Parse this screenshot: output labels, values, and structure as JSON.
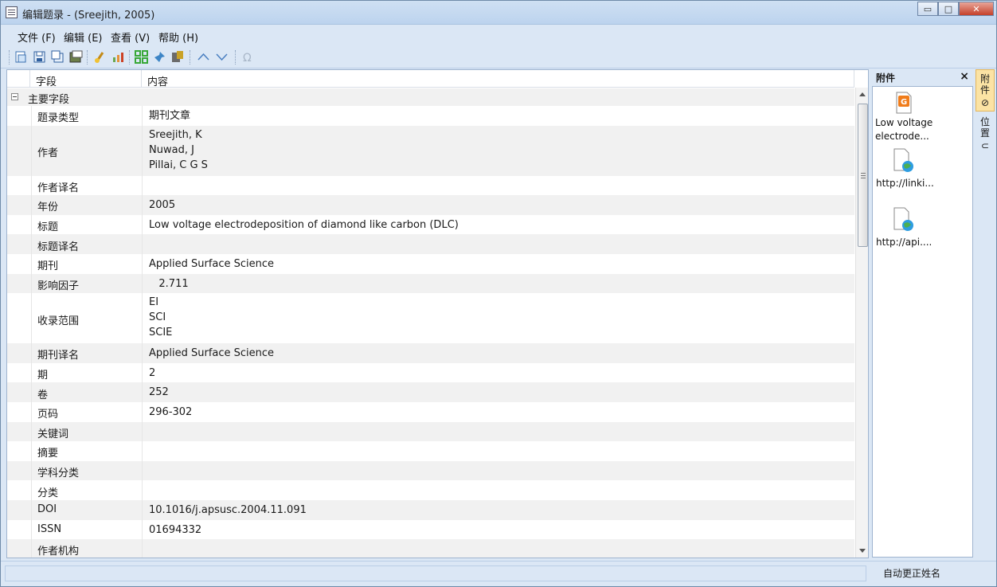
{
  "window": {
    "title": "编辑题录 - (Sreejith, 2005)",
    "min_glyph": "▭",
    "max_glyph": "□",
    "close_glyph": "✕"
  },
  "menu": [
    {
      "label": "文件 (F)"
    },
    {
      "label": "编辑 (E)"
    },
    {
      "label": "查看 (V)"
    },
    {
      "label": "帮助 (H)"
    }
  ],
  "toolbar_icons": [
    "new-doc-icon",
    "save-icon",
    "save-copy-icon",
    "export-icon",
    "clean-icon",
    "chart-icon",
    "grid-icon",
    "pin-icon",
    "book-icon",
    "move-up-icon",
    "move-down-icon",
    "omega-icon"
  ],
  "grid": {
    "col_field": "字段",
    "col_content": "内容",
    "group_label": "主要字段",
    "rows": [
      {
        "field": "题录类型",
        "value": "期刊文章"
      },
      {
        "field": "作者",
        "value": "Sreejith, K\nNuwad, J\nPillai, C G S"
      },
      {
        "field": "作者译名",
        "value": ""
      },
      {
        "field": "年份",
        "value": "2005"
      },
      {
        "field": "标题",
        "value": "Low voltage electrodeposition of diamond like carbon (DLC)"
      },
      {
        "field": "标题译名",
        "value": ""
      },
      {
        "field": "期刊",
        "value": "Applied Surface Science"
      },
      {
        "field": "影响因子",
        "value": "   2.711"
      },
      {
        "field": "收录范围",
        "value": "EI\nSCI\nSCIE"
      },
      {
        "field": "期刊译名",
        "value": "Applied Surface Science"
      },
      {
        "field": "期",
        "value": "2"
      },
      {
        "field": "卷",
        "value": "252"
      },
      {
        "field": "页码",
        "value": "296-302"
      },
      {
        "field": "关键词",
        "value": ""
      },
      {
        "field": "摘要",
        "value": ""
      },
      {
        "field": "学科分类",
        "value": ""
      },
      {
        "field": "分类",
        "value": ""
      },
      {
        "field": "DOI",
        "value": "10.1016/j.apsusc.2004.11.091"
      },
      {
        "field": "ISSN",
        "value": "01694332"
      },
      {
        "field": "作者机构",
        "value": ""
      }
    ]
  },
  "attachments": {
    "title": "附件",
    "close": "×",
    "items": [
      {
        "label": "Low voltage electrode...",
        "icon": "pdf-file-icon"
      },
      {
        "label": "http://linki...",
        "icon": "web-link-icon"
      },
      {
        "label": "http://api....",
        "icon": "web-link-icon"
      }
    ]
  },
  "side_tabs": [
    {
      "label": "附件",
      "glyph": "⊘"
    },
    {
      "label": "位置",
      "glyph": "⊂"
    }
  ],
  "status": {
    "right_text": "自动更正姓名"
  },
  "colors": {
    "chrome": "#dbe7f5",
    "row_alt": "#f1f1f1",
    "active_tab": "#fbe3a4"
  }
}
